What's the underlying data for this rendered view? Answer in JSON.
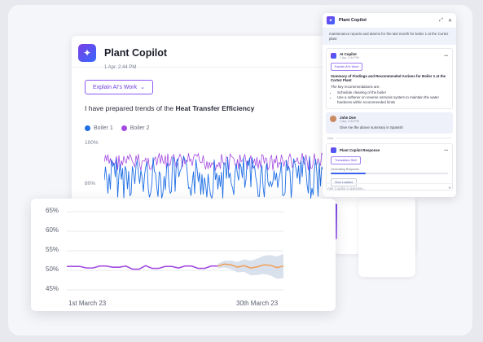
{
  "app": {
    "title": "Plant Copilot",
    "logo_icon": "sparkles-icon",
    "brand_gradient": [
      "#7b3fe4",
      "#3867ff"
    ]
  },
  "main": {
    "timestamp": "1 Apr, 2:44 PM",
    "explain_button": "Explain AI's Work",
    "message_prefix": "I have prepared trends of the ",
    "message_bold": "Heat Transfer Efficiency",
    "legend": [
      {
        "name": "Boiler 1",
        "color": "#1f6fe5"
      },
      {
        "name": "Boiler 2",
        "color": "#a34be0"
      }
    ],
    "trend_yticks": [
      "100%",
      "80%"
    ]
  },
  "copilot": {
    "title": "Plant Copilot",
    "intro": "maintenance reports and alarms for the last month for boiler 1 at the Cortez plant",
    "ai_name": "AI Copilot",
    "ai_time": "1 Apr, 2:44 PM",
    "ai_button": "Explain AI's Work",
    "summary_title": "Summary of Findings and Recommended Actions for Boiler 1 at the Cortez Plant",
    "recommend_intro": "The key recommendations are:",
    "recommendations": [
      "Schedule cleaning of the boiler",
      "Use a softener on reverse osmosis system to maintain the water hardness within recommended limits"
    ],
    "user_name": "John Doe",
    "user_time": "1 Apr, 2:44 PM",
    "user_message": "Give me the above summary in Spanish",
    "divider_label": "Now",
    "response_title": "Plant Copilot Response",
    "translate_button": "Translation Skill",
    "progress_label": "Generating Response",
    "progress": 0.3,
    "stop_button": "Stop Loading",
    "input_placeholder": "Ask Copilot a question...",
    "send_icon": "send-icon"
  },
  "chart_data": {
    "type": "line",
    "title": "",
    "xlabel": "",
    "ylabel": "",
    "x_tick_labels": [
      "1st March 23",
      "30th March 23"
    ],
    "y_tick_labels": [
      "65%",
      "60%",
      "55%",
      "50%",
      "45%"
    ],
    "ylim": [
      45,
      65
    ],
    "grid": true,
    "series": [
      {
        "color": "#a34be0",
        "values": [
          51,
          51,
          51,
          50.6,
          50.6,
          51.1,
          51.1,
          50.8,
          50.8,
          51.1,
          50.3,
          50.3,
          51.2,
          50.5,
          50.5,
          51,
          51,
          50.6,
          51.1,
          51.1,
          50.5,
          50.5,
          51.1,
          51.1
        ]
      },
      {
        "color": "#f0a15e",
        "band_color": "#cfd9e8",
        "forecast_start_index": 23,
        "values": [
          51.1,
          51.6,
          51.4,
          50.8,
          51.2,
          50.6,
          50.9,
          51.4,
          51.3,
          50.7,
          51.1
        ]
      }
    ]
  }
}
